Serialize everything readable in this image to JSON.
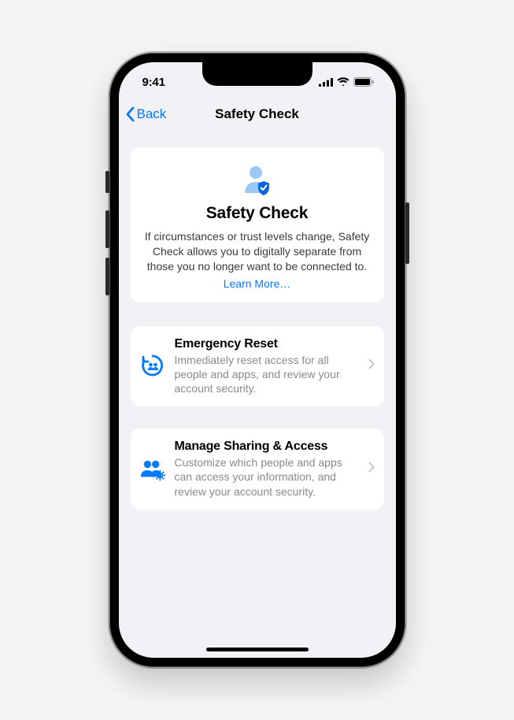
{
  "status": {
    "time": "9:41"
  },
  "nav": {
    "back_label": "Back",
    "title": "Safety Check"
  },
  "hero": {
    "title": "Safety Check",
    "description": "If circumstances or trust levels change, Safety Check allows you to digitally separate from those you no longer want to be connected to.",
    "learn_more": "Learn More…"
  },
  "options": [
    {
      "title": "Emergency Reset",
      "description": "Immediately reset access for all people and apps, and review your account security."
    },
    {
      "title": "Manage Sharing & Access",
      "description": "Customize which people and apps can access your information, and review your account security."
    }
  ]
}
